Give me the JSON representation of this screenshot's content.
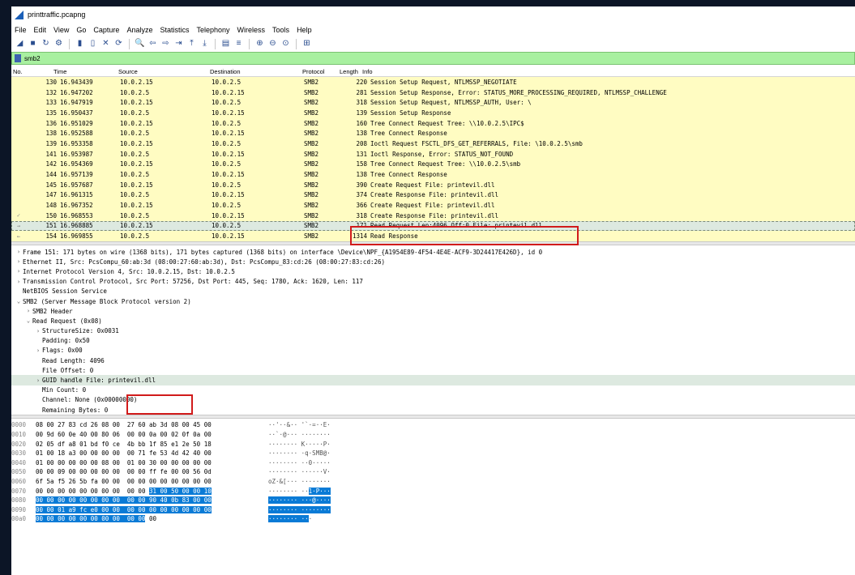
{
  "window": {
    "title": "printtraffic.pcapng"
  },
  "menu": [
    "File",
    "Edit",
    "View",
    "Go",
    "Capture",
    "Analyze",
    "Statistics",
    "Telephony",
    "Wireless",
    "Tools",
    "Help"
  ],
  "toolbar": {
    "icons": [
      "shark-fin-start-icon",
      "stop-icon",
      "restart-icon",
      "capture-options-icon",
      "open-file-icon",
      "save-file-icon",
      "close-file-icon",
      "reload-icon",
      "find-packet-icon",
      "go-back-icon",
      "go-forward-icon",
      "go-to-packet-icon",
      "first-packet-icon",
      "last-packet-icon",
      "autoscroll-icon",
      "colorize-icon",
      "zoom-in-icon",
      "zoom-out-icon",
      "normal-size-icon",
      "resize-columns-icon"
    ],
    "glyphs": [
      "◢",
      "■",
      "↻",
      "⚙",
      "▮",
      "▯",
      "✕",
      "⟳",
      "🔍",
      "⇦",
      "⇨",
      "⇥",
      "⤒",
      "⤓",
      "▤",
      "≡",
      "⊕",
      "⊖",
      "⊙",
      "⊞"
    ]
  },
  "filter": {
    "value": "smb2"
  },
  "packet_list": {
    "headers": {
      "no": "No.",
      "time": "Time",
      "source": "Source",
      "destination": "Destination",
      "protocol": "Protocol",
      "length": "Length",
      "info": "Info"
    },
    "rows": [
      {
        "no": "130",
        "time": "16.943439",
        "source": "10.0.2.15",
        "destination": "10.0.2.5",
        "protocol": "SMB2",
        "length": "220",
        "info": "Session Setup Request, NTLMSSP_NEGOTIATE",
        "mark": ""
      },
      {
        "no": "132",
        "time": "16.947202",
        "source": "10.0.2.5",
        "destination": "10.0.2.15",
        "protocol": "SMB2",
        "length": "281",
        "info": "Session Setup Response, Error: STATUS_MORE_PROCESSING_REQUIRED, NTLMSSP_CHALLENGE",
        "mark": ""
      },
      {
        "no": "133",
        "time": "16.947919",
        "source": "10.0.2.15",
        "destination": "10.0.2.5",
        "protocol": "SMB2",
        "length": "318",
        "info": "Session Setup Request, NTLMSSP_AUTH, User: \\",
        "mark": ""
      },
      {
        "no": "135",
        "time": "16.950437",
        "source": "10.0.2.5",
        "destination": "10.0.2.15",
        "protocol": "SMB2",
        "length": "139",
        "info": "Session Setup Response",
        "mark": ""
      },
      {
        "no": "136",
        "time": "16.951029",
        "source": "10.0.2.15",
        "destination": "10.0.2.5",
        "protocol": "SMB2",
        "length": "160",
        "info": "Tree Connect Request Tree: \\\\10.0.2.5\\IPC$",
        "mark": ""
      },
      {
        "no": "138",
        "time": "16.952588",
        "source": "10.0.2.5",
        "destination": "10.0.2.15",
        "protocol": "SMB2",
        "length": "138",
        "info": "Tree Connect Response",
        "mark": ""
      },
      {
        "no": "139",
        "time": "16.953358",
        "source": "10.0.2.15",
        "destination": "10.0.2.5",
        "protocol": "SMB2",
        "length": "208",
        "info": "Ioctl Request FSCTL_DFS_GET_REFERRALS, File: \\10.0.2.5\\smb",
        "mark": ""
      },
      {
        "no": "141",
        "time": "16.953987",
        "source": "10.0.2.5",
        "destination": "10.0.2.15",
        "protocol": "SMB2",
        "length": "131",
        "info": "Ioctl Response, Error: STATUS_NOT_FOUND",
        "mark": ""
      },
      {
        "no": "142",
        "time": "16.954369",
        "source": "10.0.2.15",
        "destination": "10.0.2.5",
        "protocol": "SMB2",
        "length": "158",
        "info": "Tree Connect Request Tree: \\\\10.0.2.5\\smb",
        "mark": ""
      },
      {
        "no": "144",
        "time": "16.957139",
        "source": "10.0.2.5",
        "destination": "10.0.2.15",
        "protocol": "SMB2",
        "length": "138",
        "info": "Tree Connect Response",
        "mark": ""
      },
      {
        "no": "145",
        "time": "16.957687",
        "source": "10.0.2.15",
        "destination": "10.0.2.5",
        "protocol": "SMB2",
        "length": "390",
        "info": "Create Request File: printevil.dll",
        "mark": ""
      },
      {
        "no": "147",
        "time": "16.961315",
        "source": "10.0.2.5",
        "destination": "10.0.2.15",
        "protocol": "SMB2",
        "length": "374",
        "info": "Create Response File: printevil.dll",
        "mark": ""
      },
      {
        "no": "148",
        "time": "16.967352",
        "source": "10.0.2.15",
        "destination": "10.0.2.5",
        "protocol": "SMB2",
        "length": "366",
        "info": "Create Request File: printevil.dll",
        "mark": ""
      },
      {
        "no": "150",
        "time": "16.968553",
        "source": "10.0.2.5",
        "destination": "10.0.2.15",
        "protocol": "SMB2",
        "length": "318",
        "info": "Create Response File: printevil.dll",
        "mark": "✓"
      },
      {
        "no": "151",
        "time": "16.968885",
        "source": "10.0.2.15",
        "destination": "10.0.2.5",
        "protocol": "SMB2",
        "length": "171",
        "info": "Read Request Len:4096 Off:0 File: printevil.dll",
        "mark": "→",
        "selected": true
      },
      {
        "no": "154",
        "time": "16.969855",
        "source": "10.0.2.5",
        "destination": "10.0.2.15",
        "protocol": "SMB2",
        "length": "1314",
        "info": "Read Response",
        "mark": "←"
      }
    ]
  },
  "details": [
    {
      "indent": 0,
      "arrow": "›",
      "text": "Frame 151: 171 bytes on wire (1368 bits), 171 bytes captured (1368 bits) on interface \\Device\\NPF_{A1954E89-4F54-4E4E-ACF9-3D24417E426D}, id 0"
    },
    {
      "indent": 0,
      "arrow": "›",
      "text": "Ethernet II, Src: PcsCompu_60:ab:3d (08:00:27:60:ab:3d), Dst: PcsCompu_83:cd:26 (08:00:27:83:cd:26)"
    },
    {
      "indent": 0,
      "arrow": "›",
      "text": "Internet Protocol Version 4, Src: 10.0.2.15, Dst: 10.0.2.5"
    },
    {
      "indent": 0,
      "arrow": "›",
      "text": "Transmission Control Protocol, Src Port: 57256, Dst Port: 445, Seq: 1780, Ack: 1620, Len: 117"
    },
    {
      "indent": 0,
      "arrow": "",
      "text": "NetBIOS Session Service"
    },
    {
      "indent": 0,
      "arrow": "⌄",
      "text": "SMB2 (Server Message Block Protocol version 2)"
    },
    {
      "indent": 1,
      "arrow": "›",
      "text": "SMB2 Header"
    },
    {
      "indent": 1,
      "arrow": "⌄",
      "text": "Read Request (0x08)"
    },
    {
      "indent": 2,
      "arrow": "›",
      "text": "StructureSize: 0x0031"
    },
    {
      "indent": 2,
      "arrow": "",
      "text": "Padding: 0x50"
    },
    {
      "indent": 2,
      "arrow": "›",
      "text": "Flags: 0x00"
    },
    {
      "indent": 2,
      "arrow": "",
      "text": "Read Length: 4096"
    },
    {
      "indent": 2,
      "arrow": "",
      "text": "File Offset: 0"
    },
    {
      "indent": 2,
      "arrow": "›",
      "text": "GUID handle File: printevil.dll",
      "selected": true
    },
    {
      "indent": 2,
      "arrow": "",
      "text": "Min Count: 0"
    },
    {
      "indent": 2,
      "arrow": "",
      "text": "Channel: None (0x00000000)"
    },
    {
      "indent": 2,
      "arrow": "",
      "text": "Remaining Bytes: 0"
    }
  ],
  "hex_dump": [
    {
      "offset": "0000",
      "bytes": "08 00 27 83 cd 26 08 00  27 60 ab 3d 08 00 45 00",
      "ascii": "··'··&·· '`·=··E·",
      "hl_bytes": "",
      "hl_ascii": ""
    },
    {
      "offset": "0010",
      "bytes": "00 9d 60 0e 40 00 80 06  00 00 0a 00 02 0f 0a 00",
      "ascii": "··`·@··· ········",
      "hl_bytes": "",
      "hl_ascii": ""
    },
    {
      "offset": "0020",
      "bytes": "02 05 df a8 01 bd f0 ce  4b bb 1f 85 e1 2e 50 18",
      "ascii": "········ K·····P·",
      "hl_bytes": "",
      "hl_ascii": ""
    },
    {
      "offset": "0030",
      "bytes": "01 00 18 a3 00 00 00 00  00 71 fe 53 4d 42 40 00",
      "ascii": "········ ·q·SMB@·",
      "hl_bytes": "",
      "hl_ascii": ""
    },
    {
      "offset": "0040",
      "bytes": "01 00 00 00 00 00 08 00  01 00 30 00 00 00 00 00",
      "ascii": "········ ··0·····",
      "hl_bytes": "",
      "hl_ascii": ""
    },
    {
      "offset": "0050",
      "bytes": "00 00 09 00 00 00 00 00  00 00 ff fe 00 00 56 0d",
      "ascii": "········ ······V·",
      "hl_bytes": "",
      "hl_ascii": ""
    },
    {
      "offset": "0060",
      "bytes": "6f 5a f5 26 5b fa 00 00  00 00 00 00 00 00 00 00",
      "ascii": "oZ·&[··· ········",
      "hl_bytes": "",
      "hl_ascii": ""
    },
    {
      "offset": "0070",
      "bytes": "00 00 00 00 00 00 00 00  00 00 ",
      "ascii": "········ ··",
      "hl_bytes": "31 00 50 00 00 10",
      "hl_ascii": "1·P···"
    },
    {
      "offset": "0080",
      "bytes": "",
      "ascii": "",
      "hl_bytes": "00 00 00 00 00 00 00 00  00 00 90 40 0b 83 00 00",
      "hl_ascii": "········ ···@····"
    },
    {
      "offset": "0090",
      "bytes": "",
      "ascii": "",
      "hl_bytes": "00 00 01 a9 fc e0 00 00  00 00 00 00 00 00 00 00",
      "hl_ascii": "········ ········"
    },
    {
      "offset": "00a0",
      "bytes": "",
      "ascii": "",
      "hl_bytes": "00 00 00 00 00 00 00 00  00 00",
      "hl_ascii": "········ ··",
      "tail_bytes": " 00",
      "tail_ascii": "·"
    }
  ],
  "colors": {
    "row_bg": "#fffcc2",
    "selected_bg": "#dde9e0",
    "filter_bg": "#a8f0a0",
    "highlight": "#d11b1b",
    "hex_select": "#0a7bd6"
  }
}
